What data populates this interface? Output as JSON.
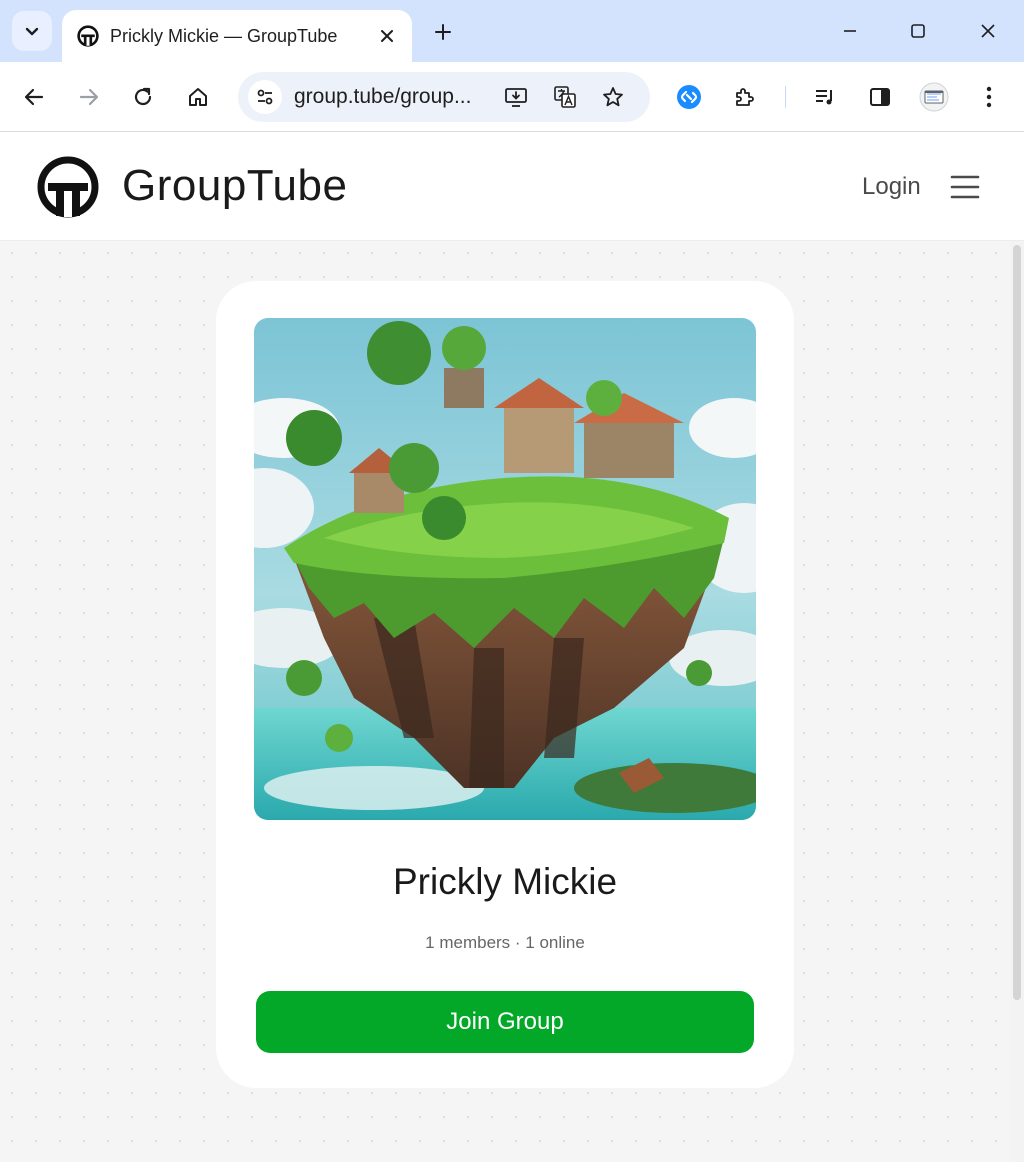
{
  "browser": {
    "tab_title": "Prickly Mickie — GroupTube",
    "url": "group.tube/group...",
    "icons": {
      "tab_search": "chevron-down-icon",
      "tab_close": "close-icon",
      "new_tab": "plus-icon",
      "back": "back-arrow-icon",
      "forward": "forward-arrow-icon",
      "reload": "reload-icon",
      "home": "home-icon",
      "site_info": "tune-icon",
      "install": "install-app-icon",
      "translate": "translate-icon",
      "bookmark": "star-icon",
      "shazam": "shazam-extension-icon",
      "extensions": "puzzle-icon",
      "media": "media-controls-icon",
      "side_panel": "side-panel-icon",
      "profile": "profile-avatar-icon",
      "menu": "kebab-menu-icon"
    }
  },
  "header": {
    "site_name": "GroupTube",
    "login_label": "Login"
  },
  "group": {
    "name": "Prickly Mickie",
    "stats": "1 members · 1 online",
    "join_label": "Join Group"
  },
  "colors": {
    "tabstrip": "#d3e3fd",
    "omnibox": "#edf2fa",
    "join_button": "#03a829",
    "page_background": "#f5f5f5"
  }
}
